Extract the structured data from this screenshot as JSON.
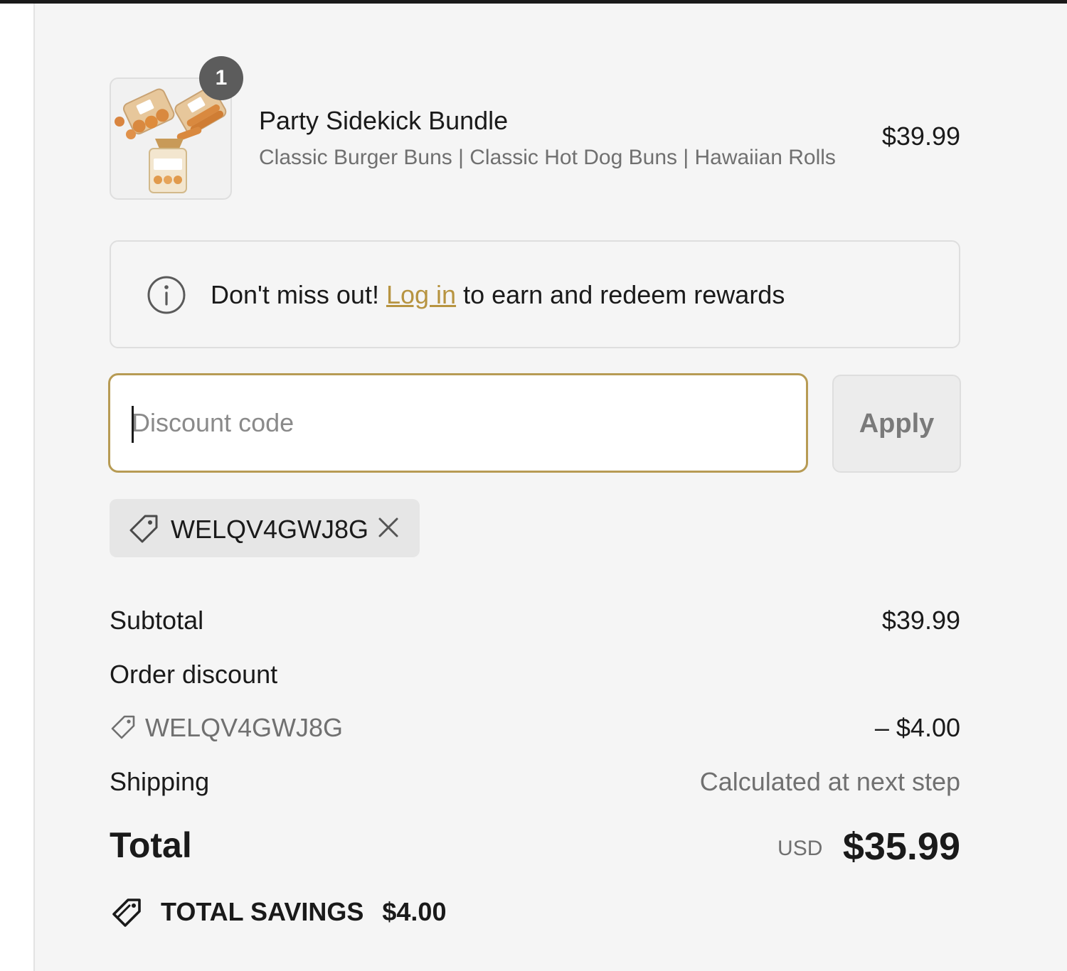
{
  "colors": {
    "accent": "#b79441",
    "badge": "#5c5c5c",
    "panel_bg": "#f5f5f5"
  },
  "cart": {
    "items": [
      {
        "name": "Party Sidekick Bundle",
        "variant": "Classic Burger Buns | Classic Hot Dog Buns | Hawaiian Rolls",
        "price": "$39.99",
        "quantity": "1"
      }
    ]
  },
  "notice": {
    "icon": "info-icon",
    "prefix": "Don't miss out!",
    "link": "Log in",
    "suffix": "to earn and redeem rewards"
  },
  "discount": {
    "placeholder": "Discount code",
    "value": "",
    "apply_label": "Apply",
    "applied_code": "WELQV4GWJ8G"
  },
  "summary": {
    "subtotal_label": "Subtotal",
    "subtotal_value": "$39.99",
    "order_discount_label": "Order discount",
    "discount_code": "WELQV4GWJ8G",
    "discount_value": "– $4.00",
    "shipping_label": "Shipping",
    "shipping_value": "Calculated at next step",
    "total_label": "Total",
    "currency": "USD",
    "total_value": "$35.99",
    "savings_label": "TOTAL SAVINGS",
    "savings_value": "$4.00"
  }
}
